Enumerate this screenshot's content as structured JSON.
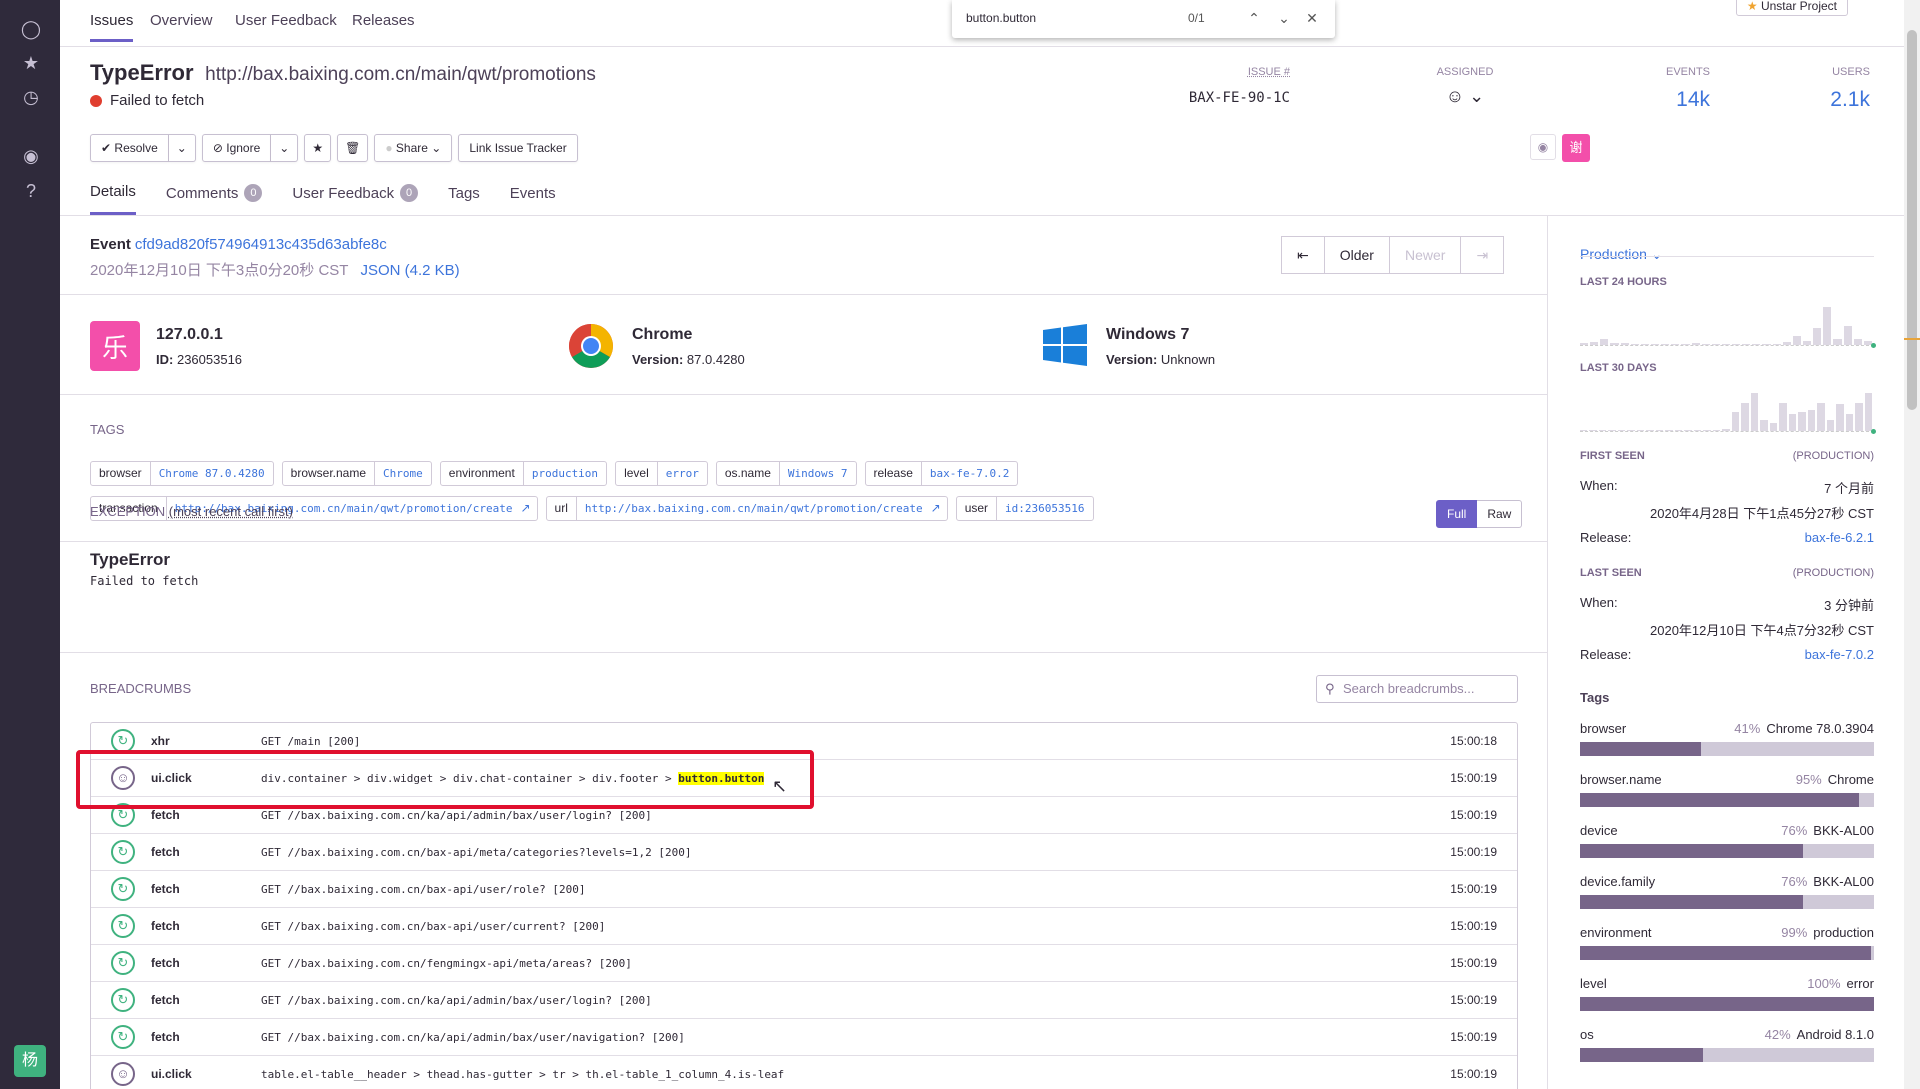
{
  "nav": {
    "tabs": [
      "Issues",
      "Overview",
      "User Feedback",
      "Releases"
    ],
    "unstar_label": "Unstar Project"
  },
  "find": {
    "query": "button.button",
    "count": "0/1"
  },
  "issue": {
    "title": "TypeError",
    "url": "http://bax.baixing.com.cn/main/qwt/promotions",
    "subtitle": "Failed to fetch",
    "issue_label": "ISSUE #",
    "issue_id": "BAX-FE-90-1C",
    "assigned_label": "ASSIGNED",
    "events_label": "EVENTS",
    "events_val": "14k",
    "users_label": "USERS",
    "users_val": "2.1k",
    "avatar_char": "谢"
  },
  "toolbar": {
    "resolve": "Resolve",
    "ignore": "Ignore",
    "share": "Share",
    "link": "Link Issue Tracker"
  },
  "subtabs": {
    "details": "Details",
    "comments": "Comments",
    "comments_n": "0",
    "feedback": "User Feedback",
    "feedback_n": "0",
    "tags": "Tags",
    "events": "Events"
  },
  "event": {
    "label": "Event",
    "id": "cfd9ad820f574964913c435d63abfe8c",
    "date": "2020年12月10日 下午3点0分20秒 CST",
    "json": "JSON (4.2 KB)",
    "older": "Older",
    "newer": "Newer"
  },
  "context": {
    "user": {
      "char": "乐",
      "title": "127.0.0.1",
      "id_label": "ID:",
      "id": "236053516"
    },
    "browser": {
      "title": "Chrome",
      "ver_label": "Version:",
      "ver": "87.0.4280"
    },
    "os": {
      "title": "Windows 7",
      "ver_label": "Version:",
      "ver": "Unknown"
    }
  },
  "tags_title": "TAGS",
  "tags": [
    {
      "k": "browser",
      "v": "Chrome 87.0.4280"
    },
    {
      "k": "browser.name",
      "v": "Chrome"
    },
    {
      "k": "environment",
      "v": "production"
    },
    {
      "k": "level",
      "v": "error"
    },
    {
      "k": "os.name",
      "v": "Windows 7"
    },
    {
      "k": "release",
      "v": "bax-fe-7.0.2"
    },
    {
      "k": "transaction",
      "v": "http://bax.baixing.com.cn/main/qwt/promotion/create"
    },
    {
      "k": "url",
      "v": "http://bax.baixing.com.cn/main/qwt/promotion/create"
    },
    {
      "k": "user",
      "v": "id:236053516"
    }
  ],
  "exception": {
    "title": "EXCEPTION",
    "paren": "(most recent call first)",
    "full": "Full",
    "raw": "Raw",
    "type": "TypeError",
    "msg": "Failed to fetch"
  },
  "breadcrumbs": {
    "title": "BREADCRUMBS",
    "search_placeholder": "Search breadcrumbs...",
    "rows": [
      {
        "type": "xhr",
        "msg": "GET /main [200]",
        "time": "15:00:18",
        "icon": "refresh"
      },
      {
        "type": "ui.click",
        "msg": "div.container > div.widget > div.chat-container > div.footer > ",
        "hl": "button.button",
        "time": "15:00:19",
        "icon": "user"
      },
      {
        "type": "fetch",
        "msg": "GET //bax.baixing.com.cn/ka/api/admin/bax/user/login? [200]",
        "time": "15:00:19",
        "icon": "refresh"
      },
      {
        "type": "fetch",
        "msg": "GET //bax.baixing.com.cn/bax-api/meta/categories?levels=1,2 [200]",
        "time": "15:00:19",
        "icon": "refresh"
      },
      {
        "type": "fetch",
        "msg": "GET //bax.baixing.com.cn/bax-api/user/role? [200]",
        "time": "15:00:19",
        "icon": "refresh"
      },
      {
        "type": "fetch",
        "msg": "GET //bax.baixing.com.cn/bax-api/user/current? [200]",
        "time": "15:00:19",
        "icon": "refresh"
      },
      {
        "type": "fetch",
        "msg": "GET //bax.baixing.com.cn/fengmingx-api/meta/areas? [200]",
        "time": "15:00:19",
        "icon": "refresh"
      },
      {
        "type": "fetch",
        "msg": "GET //bax.baixing.com.cn/ka/api/admin/bax/user/login? [200]",
        "time": "15:00:19",
        "icon": "refresh"
      },
      {
        "type": "fetch",
        "msg": "GET //bax.baixing.com.cn/ka/api/admin/bax/user/navigation? [200]",
        "time": "15:00:19",
        "icon": "refresh"
      },
      {
        "type": "ui.click",
        "msg": "table.el-table__header > thead.has-gutter > tr > th.el-table_1_column_4.is-leaf",
        "time": "15:00:19",
        "icon": "user"
      }
    ]
  },
  "side": {
    "env": "Production",
    "last24": "LAST 24 HOURS",
    "last30": "LAST 30 DAYS",
    "first_seen": "FIRST SEEN",
    "last_seen": "LAST SEEN",
    "prod": "(PRODUCTION)",
    "when": "When:",
    "release": "Release:",
    "fs_when": "7 个月前",
    "fs_date": "2020年4月28日 下午1点45分27秒 CST",
    "fs_rel": "bax-fe-6.2.1",
    "ls_when": "3 分钟前",
    "ls_date": "2020年12月10日 下午4点7分32秒 CST",
    "ls_rel": "bax-fe-7.0.2",
    "tags_title": "Tags",
    "tags": [
      {
        "k": "browser",
        "pct": "41%",
        "v": "Chrome 78.0.3904",
        "frac": 0.41
      },
      {
        "k": "browser.name",
        "pct": "95%",
        "v": "Chrome",
        "frac": 0.95
      },
      {
        "k": "device",
        "pct": "76%",
        "v": "BKK-AL00",
        "frac": 0.76
      },
      {
        "k": "device.family",
        "pct": "76%",
        "v": "BKK-AL00",
        "frac": 0.76
      },
      {
        "k": "environment",
        "pct": "99%",
        "v": "production",
        "frac": 0.99
      },
      {
        "k": "level",
        "pct": "100%",
        "v": "error",
        "frac": 1.0
      },
      {
        "k": "os",
        "pct": "42%",
        "v": "Android 8.1.0",
        "frac": 0.42
      }
    ]
  },
  "sidebar": {
    "avatar_char": "杨"
  }
}
